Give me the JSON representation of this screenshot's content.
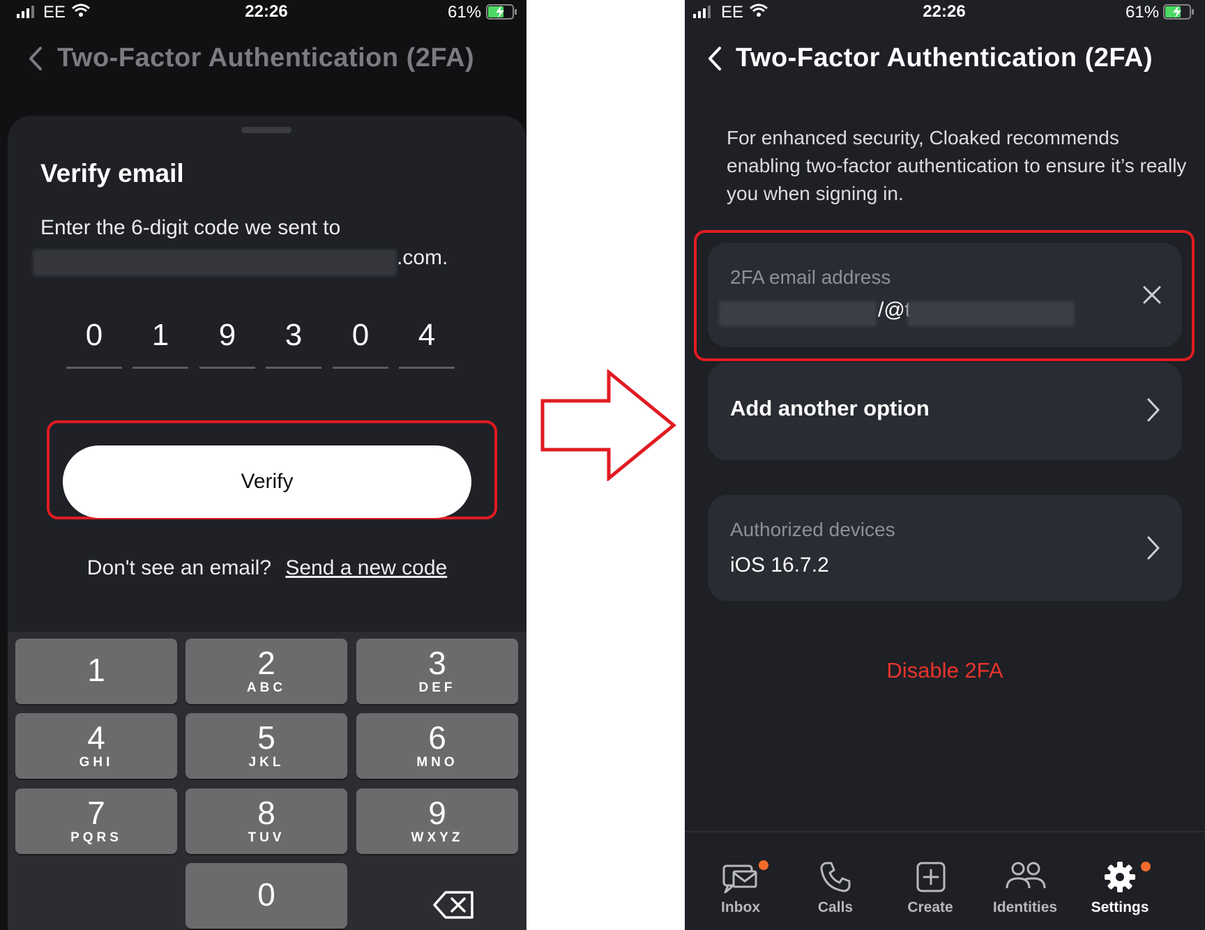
{
  "status_bar": {
    "carrier": "EE",
    "time": "22:26",
    "battery": "61%"
  },
  "left_screen": {
    "header_title": "Two-Factor Authentication (2FA)",
    "sheet_title": "Verify email",
    "description": "Enter the 6-digit code we sent to",
    "email_suffix": ".com.",
    "code_digits": [
      "0",
      "1",
      "9",
      "3",
      "0",
      "4"
    ],
    "verify_label": "Verify",
    "resend_prompt": "Don't see an email?",
    "resend_link": "Send a new code",
    "keypad": [
      {
        "num": "1",
        "letters": ""
      },
      {
        "num": "2",
        "letters": "ABC"
      },
      {
        "num": "3",
        "letters": "DEF"
      },
      {
        "num": "4",
        "letters": "GHI"
      },
      {
        "num": "5",
        "letters": "JKL"
      },
      {
        "num": "6",
        "letters": "MNO"
      },
      {
        "num": "7",
        "letters": "PQRS"
      },
      {
        "num": "8",
        "letters": "TUV"
      },
      {
        "num": "9",
        "letters": "WXYZ"
      },
      {
        "num": "0",
        "letters": ""
      }
    ]
  },
  "right_screen": {
    "header_title": "Two-Factor Authentication (2FA)",
    "intro": "For enhanced security, Cloaked recommends enabling two-factor authentication to ensure it’s really you when signing in.",
    "email_card": {
      "label": "2FA email address",
      "value_visible": "/@t"
    },
    "add_option_label": "Add another option",
    "devices_card": {
      "label": "Authorized devices",
      "value": "iOS 16.7.2"
    },
    "disable_label": "Disable 2FA",
    "tabs": [
      {
        "label": "Inbox",
        "icon": "inbox-icon",
        "badge": true
      },
      {
        "label": "Calls",
        "icon": "phone-icon",
        "badge": false
      },
      {
        "label": "Create",
        "icon": "plus-square-icon",
        "badge": false
      },
      {
        "label": "Identities",
        "icon": "people-icon",
        "badge": false
      },
      {
        "label": "Settings",
        "icon": "gear-icon",
        "badge": true
      }
    ]
  },
  "colors": {
    "highlight": "#e01b22",
    "danger_text": "#e8342c",
    "badge": "#f26b2b",
    "battery": "#4cd964"
  }
}
